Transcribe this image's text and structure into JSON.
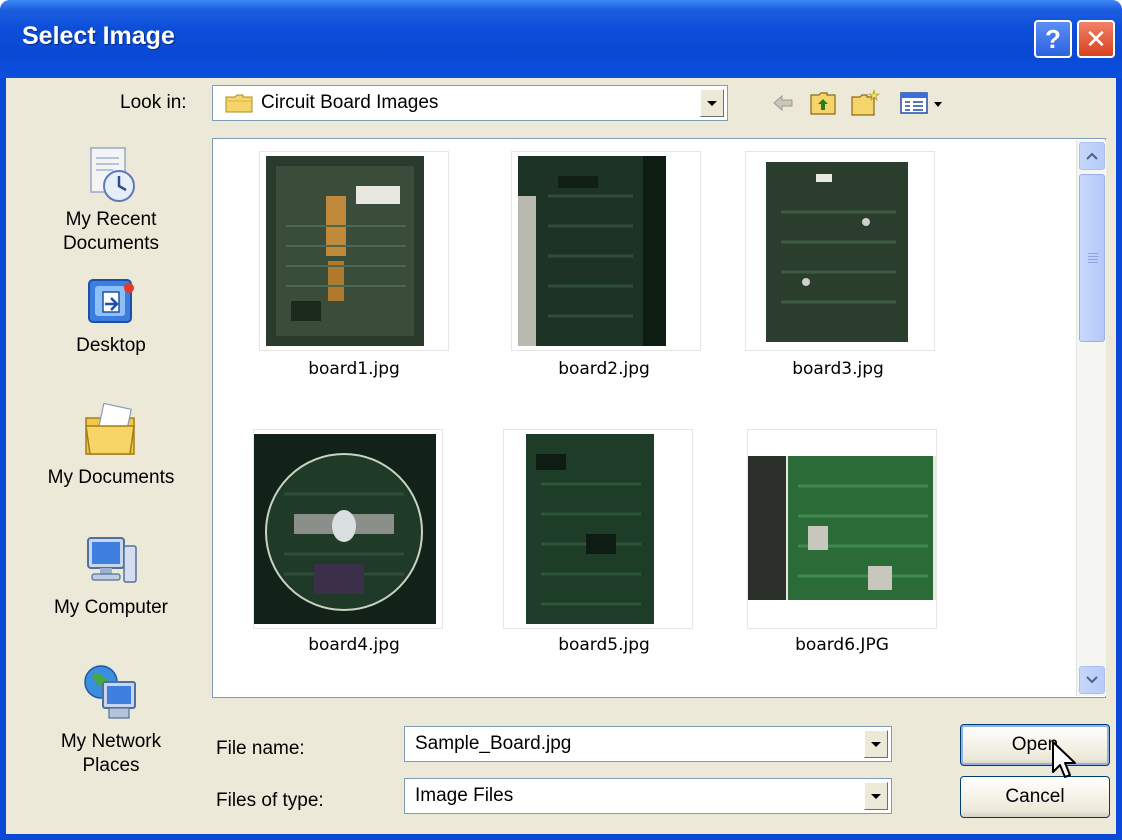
{
  "window": {
    "title": "Select Image",
    "help_label": "?",
    "close_label": "✕"
  },
  "lookin": {
    "label": "Look in:",
    "value": "Circuit Board Images"
  },
  "toolbar": {
    "icons": [
      "back-arrow-icon",
      "up-folder-icon",
      "new-folder-icon",
      "view-menu-icon"
    ]
  },
  "places": [
    {
      "label": "My Recent\nDocuments",
      "icon": "recent-documents-icon"
    },
    {
      "label": "Desktop",
      "icon": "desktop-icon"
    },
    {
      "label": "My Documents",
      "icon": "my-documents-icon"
    },
    {
      "label": "My Computer",
      "icon": "my-computer-icon"
    },
    {
      "label": "My Network\nPlaces",
      "icon": "network-places-icon"
    }
  ],
  "files": [
    {
      "name": "board1.jpg"
    },
    {
      "name": "board2.jpg"
    },
    {
      "name": "board3.jpg"
    },
    {
      "name": "board4.jpg"
    },
    {
      "name": "board5.jpg"
    },
    {
      "name": "board6.JPG"
    }
  ],
  "filename": {
    "label": "File name:",
    "value": "Sample_Board.jpg"
  },
  "filetype": {
    "label": "Files of type:",
    "value": "Image Files"
  },
  "buttons": {
    "open": "Open",
    "cancel": "Cancel"
  },
  "colors": {
    "titlebar": "#0a49d4",
    "dialog_face": "#ece9d8",
    "close_button": "#d8421f",
    "pcb_green": "#1f3a26"
  }
}
